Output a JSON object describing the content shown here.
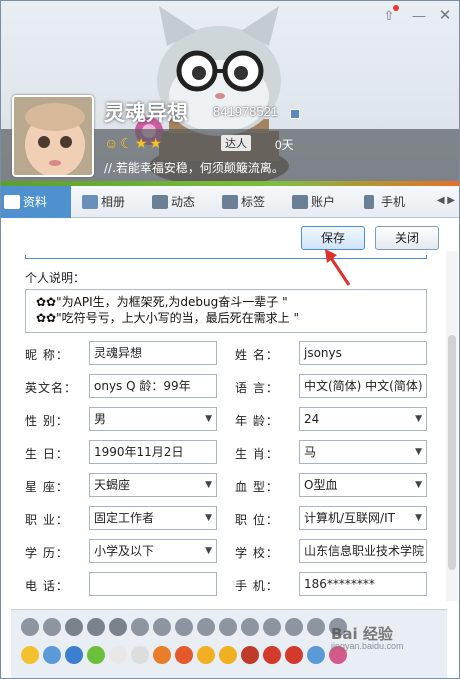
{
  "window_controls": {
    "menu_icon": "shirt-icon",
    "min_icon": "minimize-icon",
    "close_icon": "close-icon"
  },
  "profile": {
    "nickname": "灵魂异想",
    "qq_number": "841978521",
    "talent_label": "达人",
    "days": "0天",
    "signature": "//.若能幸福安稳，何须颠簸流离。"
  },
  "tabs": [
    {
      "label": "资料",
      "icon": "profile-card-icon"
    },
    {
      "label": "相册",
      "icon": "photo-album-icon"
    },
    {
      "label": "动态",
      "icon": "feed-icon"
    },
    {
      "label": "标签",
      "icon": "tag-icon"
    },
    {
      "label": "账户",
      "icon": "wallet-icon"
    },
    {
      "label": "手机",
      "icon": "phone-icon"
    }
  ],
  "buttons": {
    "save": "保存",
    "close": "关闭"
  },
  "description": {
    "label": "个人说明：",
    "line1": "✿✿\"为API生，为框架死,为debug奋斗一辈子 \"",
    "line2": "✿✿\"吃符号亏，上大小写的当，最后死在需求上 \""
  },
  "form": {
    "nickname": {
      "label": "昵    称：",
      "value": "灵魂异想"
    },
    "name": {
      "label": "姓    名：",
      "value": "jsonys"
    },
    "english_name": {
      "label": "英文名：",
      "value": "onys    Q    龄：99年"
    },
    "language": {
      "label": "语    言：",
      "value": "中文(简体)  中文(简体)"
    },
    "gender": {
      "label": "性    别：",
      "value": "男"
    },
    "age": {
      "label": "年    龄：",
      "value": "24"
    },
    "birthday": {
      "label": "生    日：",
      "value": "1990年11月2日"
    },
    "zodiac": {
      "label": "生    肖：",
      "value": "马"
    },
    "constellation": {
      "label": "星    座：",
      "value": "天蝎座"
    },
    "blood": {
      "label": "血    型：",
      "value": "O型血"
    },
    "occupation": {
      "label": "职    业：",
      "value": "固定工作者"
    },
    "position": {
      "label": "职    位：",
      "value": "计算机/互联网/IT"
    },
    "education": {
      "label": "学    历：",
      "value": "小学及以下"
    },
    "school": {
      "label": "学    校：",
      "value": "山东信息职业技术学院"
    },
    "phone": {
      "label": "电    话：",
      "value": ""
    },
    "mobile": {
      "label": "手    机：",
      "value": "186********"
    }
  },
  "watermark": {
    "text": "Bai 经验",
    "sub": "jingyan.baidu.com"
  }
}
